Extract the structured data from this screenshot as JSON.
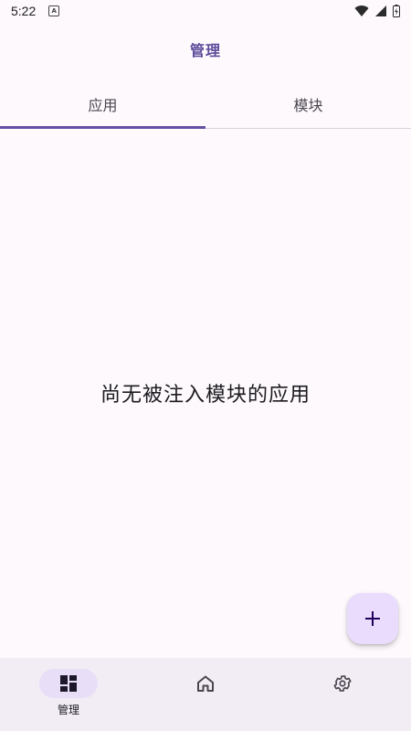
{
  "status_bar": {
    "time": "5:22",
    "app_icon_letter": "A"
  },
  "top_bar": {
    "title": "管理"
  },
  "tabs": [
    {
      "label": "应用",
      "active": true
    },
    {
      "label": "模块",
      "active": false
    }
  ],
  "empty_state": {
    "message": "尚无被注入模块的应用"
  },
  "fab": {
    "icon": "plus-icon"
  },
  "bottom_nav": {
    "items": [
      {
        "label": "管理",
        "icon": "dashboard-icon",
        "active": true
      },
      {
        "label": "",
        "icon": "home-icon",
        "active": false
      },
      {
        "label": "",
        "icon": "gear-icon",
        "active": false
      }
    ]
  },
  "colors": {
    "accent": "#6650a4",
    "title": "#5b4a9a",
    "fab_bg": "#eadcfd",
    "nav_bg": "#f2edf5",
    "nav_indicator": "#e8def8",
    "background": "#fdf9fd"
  }
}
